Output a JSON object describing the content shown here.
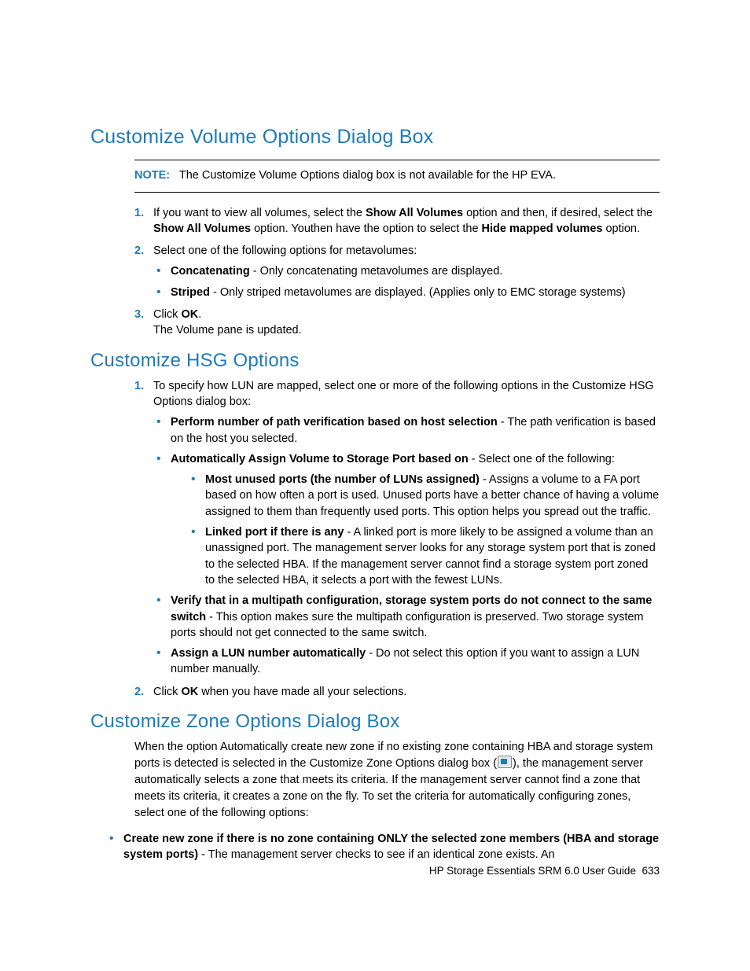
{
  "section1": {
    "title": "Customize Volume Options Dialog Box",
    "note_label": "NOTE:",
    "note_text": "The Customize Volume Options dialog box is not available for the HP EVA.",
    "items": [
      {
        "num": "1.",
        "pre": "If you want to view all volumes, select the ",
        "b1": "Show All Volumes",
        "mid1": " option and then, if desired,  select the ",
        "b2": "Show All Volumes",
        "mid2": " option. Youthen  have the option to select the ",
        "b3": "Hide mapped volumes",
        "post": " option."
      },
      {
        "num": "2.",
        "text": "Select one of the following options for metavolumes:",
        "bullets": [
          {
            "b": "Concatenating",
            "rest": " - Only concatenating metavolumes are displayed."
          },
          {
            "b": "Striped",
            "rest": " - Only striped metavolumes are displayed. (Applies only to EMC storage systems)"
          }
        ]
      },
      {
        "num": "3.",
        "pre": "Click ",
        "b1": "OK",
        "post": ".",
        "followup": "The Volume pane is updated."
      }
    ]
  },
  "section2": {
    "title": "Customize HSG Options",
    "items": [
      {
        "num": "1.",
        "text": "To specify how LUN are mapped, select one or more of the following options in the Customize HSG Options dialog box:",
        "bullets": [
          {
            "b": "Perform number of path verification based on host selection",
            "rest": " - The path verification is based on the host you selected."
          },
          {
            "b": "Automatically Assign Volume to Storage Port based on",
            "rest": " - Select one of the following:",
            "sub": [
              {
                "b": "Most unused ports (the number of LUNs assigned)",
                "rest": " - Assigns a volume to a FA port based on how often a port is used. Unused ports have a better chance of having a volume assigned to them than frequently used ports. This option helps you spread out the traffic."
              },
              {
                "b": "Linked port if there is any",
                "rest": " - A linked port is more likely to be assigned a volume than an unassigned port. The management server looks for any storage system port that is zoned to the selected HBA. If the management server cannot find a storage system port zoned to the selected HBA, it selects a port with the fewest LUNs."
              }
            ]
          },
          {
            "b": "Verify that in a multipath configuration, storage system ports do not connect to the same switch",
            "rest": " - This option makes sure the multipath configuration is preserved. Two storage system ports should not get connected to the same switch."
          },
          {
            "b": "Assign a LUN number automatically",
            "rest": " - Do not select this option if you want to assign a LUN number manually."
          }
        ]
      },
      {
        "num": "2.",
        "pre": "Click ",
        "b1": "OK",
        "post": " when you have made all your selections."
      }
    ]
  },
  "section3": {
    "title": "Customize Zone Options Dialog Box",
    "intro_pre": "When the option Automatically create new zone if no existing zone containing HBA and storage system ports is detected is selected in the Customize Zone Options dialog box (",
    "intro_post": "), the management server automatically selects a zone that meets its criteria. If the management server cannot find a zone that meets its criteria, it creates a zone on the fly. To set the criteria for automatically configuring zones, select one of the following options:",
    "bullets": [
      {
        "b": "Create new zone if there is no zone containing ONLY the selected zone members (HBA and storage system ports)",
        "rest": " - The management server checks to see if an identical zone exists. An"
      }
    ]
  },
  "footer": {
    "text": "HP Storage Essentials SRM 6.0 User Guide",
    "page": "633"
  }
}
